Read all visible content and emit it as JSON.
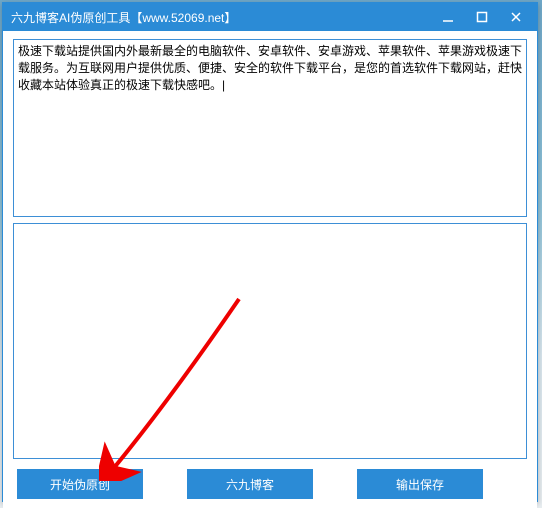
{
  "window": {
    "title": "六九博客AI伪原创工具【www.52069.net】"
  },
  "input": {
    "value": "极速下载站提供国内外最新最全的电脑软件、安卓软件、安卓游戏、苹果软件、苹果游戏极速下载服务。为互联网用户提供优质、便捷、安全的软件下载平台，是您的首选软件下载网站，赶快收藏本站体验真正的极速下载快感吧。|"
  },
  "output": {
    "value": ""
  },
  "buttons": {
    "start": "开始伪原创",
    "blog": "六九博客",
    "export": "输出保存"
  },
  "watermark": "极速下载站"
}
